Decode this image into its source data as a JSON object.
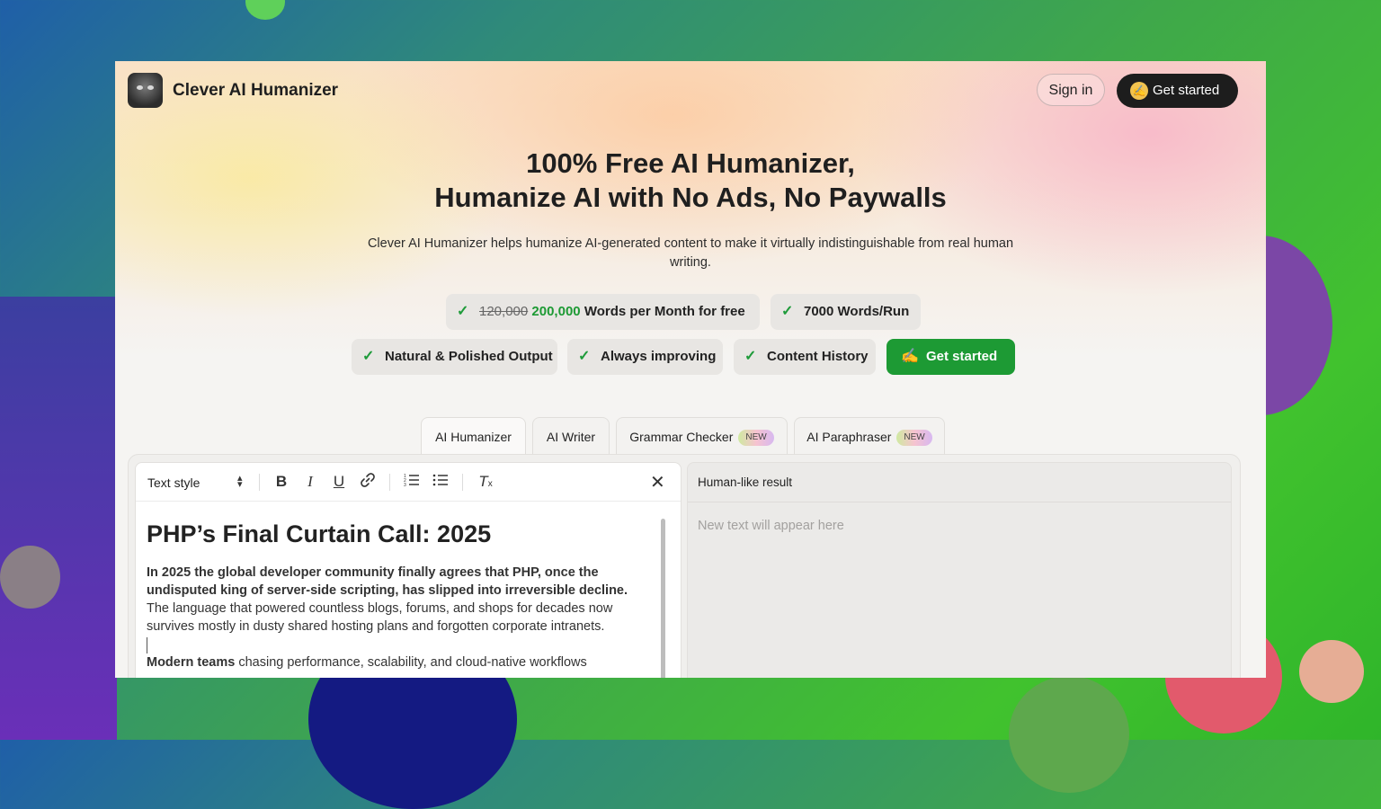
{
  "header": {
    "brand": "Clever AI Humanizer",
    "sign_in": "Sign in",
    "get_started": "Get started",
    "get_started_icon": "writing-hand-icon"
  },
  "hero": {
    "title_line1": "100% Free AI Humanizer,",
    "title_line2": "Humanize AI with No Ads, No Paywalls",
    "subtitle": "Clever AI Humanizer helps humanize AI-generated content to make it virtually indistinguishable from real human writing."
  },
  "features": {
    "words_old": "120,000",
    "words_new": "200,000",
    "words_suffix": "Words per Month for free",
    "words_per_run": "7000 Words/Run",
    "natural": "Natural & Polished Output",
    "improving": "Always improving",
    "history": "Content History",
    "cta": "Get started",
    "check_icon": "check-icon"
  },
  "tabs": [
    {
      "label": "AI Humanizer",
      "badge": ""
    },
    {
      "label": "AI Writer",
      "badge": ""
    },
    {
      "label": "Grammar Checker",
      "badge": "NEW"
    },
    {
      "label": "AI Paraphraser",
      "badge": "NEW"
    }
  ],
  "editor": {
    "text_style": "Text style",
    "doc_title": "PHP’s Final Curtain Call: 2025",
    "p1_bold": "In 2025 the global developer community finally agrees that PHP, once the undisputed king of server-side scripting, has slipped into irreversible decline.",
    "p1_rest": "The language that powered countless blogs, forums, and shops for decades now survives mostly in dusty shared hosting plans and forgotten corporate intranets.",
    "p2_bold": "Modern teams",
    "p2_rest": "chasing performance, scalability, and cloud-native workflows"
  },
  "result": {
    "title": "Human-like result",
    "placeholder": "New text will appear here"
  },
  "colors": {
    "accent_green": "#1d9a34",
    "dark_button": "#1d1d1d"
  }
}
